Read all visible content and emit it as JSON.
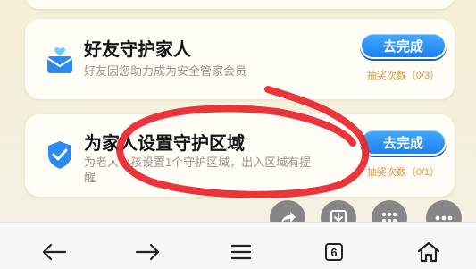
{
  "tasks": [
    {
      "title": "好友守护家人",
      "desc": "好友因您助力成为安全管家会员",
      "button": "去完成",
      "count": "抽奖次数（0/3）",
      "icon": "envelope-heart-icon"
    },
    {
      "title": "为家人设置守护区域",
      "desc": "为老人小孩设置1个守护区域，出入区域有提醒",
      "button": "去完成",
      "count": "抽奖次数（0/1）",
      "icon": "shield-check-icon"
    }
  ],
  "floating_actions": [
    "share-icon",
    "download-icon",
    "grid-icon",
    "more-icon"
  ],
  "browser_nav": {
    "back": "back-arrow-icon",
    "forward": "forward-arrow-icon",
    "menu": "menu-icon",
    "tab_count": "6",
    "home": "home-icon"
  },
  "colors": {
    "accent_blue": "#1e82f1",
    "annotation_red": "#e8242c",
    "count_orange": "#e0973a"
  }
}
